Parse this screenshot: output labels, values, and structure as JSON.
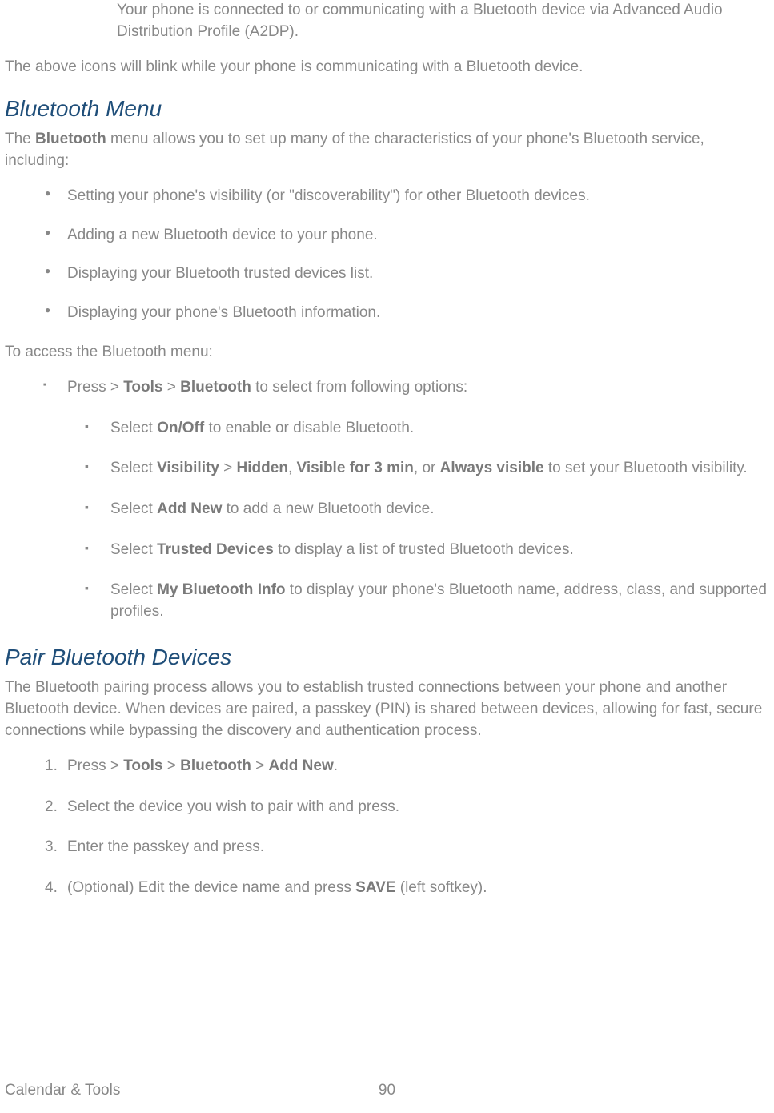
{
  "intro": {
    "indented_text": "Your phone is connected to or communicating with a Bluetooth device via Advanced Audio Distribution Profile (A2DP).",
    "blink_text": "The above icons will blink while your phone is communicating with a Bluetooth device."
  },
  "bluetooth_menu": {
    "heading": "Bluetooth Menu",
    "intro_pre": "The ",
    "intro_bold": "Bluetooth",
    "intro_post": " menu allows you to set up many of the characteristics of your phone's Bluetooth service, including:",
    "bullets": [
      "Setting your phone's visibility (or \"discoverability\") for other Bluetooth devices.",
      "Adding a new Bluetooth device to your phone.",
      "Displaying your Bluetooth trusted devices list.",
      "Displaying your phone's Bluetooth information."
    ],
    "access_label": "To access the Bluetooth menu:",
    "press_pre": "Press  > ",
    "press_b1": "Tools",
    "press_mid": " > ",
    "press_b2": "Bluetooth",
    "press_post": " to select from following options:",
    "options": [
      {
        "pre": "Select ",
        "b1": "On/Off",
        "post": " to enable or disable Bluetooth."
      },
      {
        "pre": "Select ",
        "b1": "Visibility",
        "mid1": " > ",
        "b2": "Hidden",
        "mid2": ", ",
        "b3": "Visible for 3 min",
        "mid3": ", or ",
        "b4": "Always visible",
        "post": " to set your Bluetooth visibility."
      },
      {
        "pre": "Select ",
        "b1": "Add New",
        "post": " to add a new Bluetooth device."
      },
      {
        "pre": "Select ",
        "b1": "Trusted Devices",
        "post": " to display a list of trusted Bluetooth devices."
      },
      {
        "pre": "Select ",
        "b1": "My Bluetooth Info",
        "post": " to display your phone's Bluetooth name, address, class, and supported profiles."
      }
    ]
  },
  "pair_devices": {
    "heading": "Pair Bluetooth Devices",
    "intro": "The Bluetooth pairing process allows you to establish trusted connections between your phone and another Bluetooth device. When devices are paired, a passkey (PIN) is shared between devices, allowing for fast, secure connections while bypassing the discovery and authentication process.",
    "steps": [
      {
        "pre": "Press  > ",
        "b1": "Tools",
        "mid1": " > ",
        "b2": "Bluetooth",
        "mid2": " > ",
        "b3": "Add New",
        "post": "."
      },
      {
        "text": "Select the device you wish to pair with and press."
      },
      {
        "text": "Enter the passkey and press."
      },
      {
        "pre": "(Optional) Edit the device name and press ",
        "b1": "SAVE",
        "post": " (left softkey)."
      }
    ]
  },
  "footer": {
    "left": "Calendar & Tools",
    "page": "90"
  }
}
